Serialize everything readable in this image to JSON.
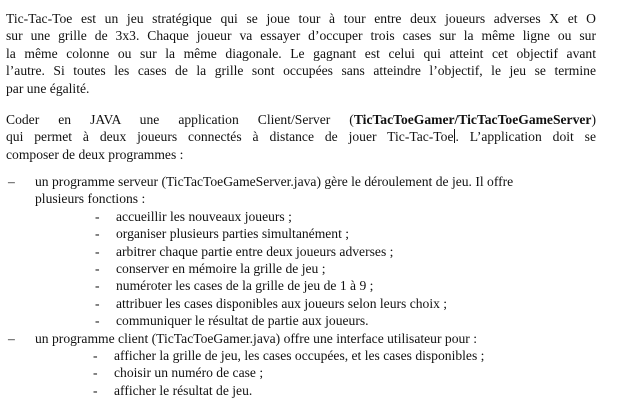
{
  "intro_lines": [
    "Tic-Tac-Toe est un jeu stratégique qui se joue tour à tour entre deux joueurs adverses X et O",
    "sur une grille de 3x3. Chaque joueur va essayer d’occuper trois cases sur la même ligne ou sur",
    "la même colonne ou sur la même diagonale. Le gagnant est celui qui atteint cet objectif avant",
    "l’autre. Si toutes les cases de la grille sont occupées sans atteindre l’objectif, le jeu se termine",
    "par une égalité."
  ],
  "task": {
    "line1_prefix": "Coder en JAVA une application Client/Server (",
    "line1_bold": "TicTacToeGamer/TicTacToeGameServer",
    "line1_suffix": ")",
    "line2_prefix": "qui permet à deux joueurs connectés à distance de jouer Tic-Tac-Toe",
    "line2_suffix": ". L’application doit se",
    "line3": "composer de deux programmes :"
  },
  "bullet_dash": "–",
  "sub_dash": "-",
  "server": {
    "line1": "un programme serveur (TicTacToeGameServer.java) gère le déroulement de jeu. Il offre",
    "line2": "plusieurs fonctions :",
    "functions": [
      "accueillir les nouveaux joueurs ;",
      "organiser plusieurs parties simultanément ;",
      "arbitrer chaque partie entre deux joueurs adverses ;",
      "conserver en mémoire la grille de jeu ;",
      "numéroter les cases de la grille de jeu de 1 à 9 ;",
      "attribuer les cases disponibles aux joueurs selon leurs choix ;",
      "communiquer le résultat de partie aux joueurs."
    ]
  },
  "client": {
    "line1": "un programme client (TicTacToeGamer.java) offre une interface utilisateur pour :",
    "functions": [
      "afficher la grille de jeu, les cases occupées, et les cases disponibles ;",
      "choisir un numéro de case ;",
      "afficher le résultat de jeu."
    ]
  }
}
